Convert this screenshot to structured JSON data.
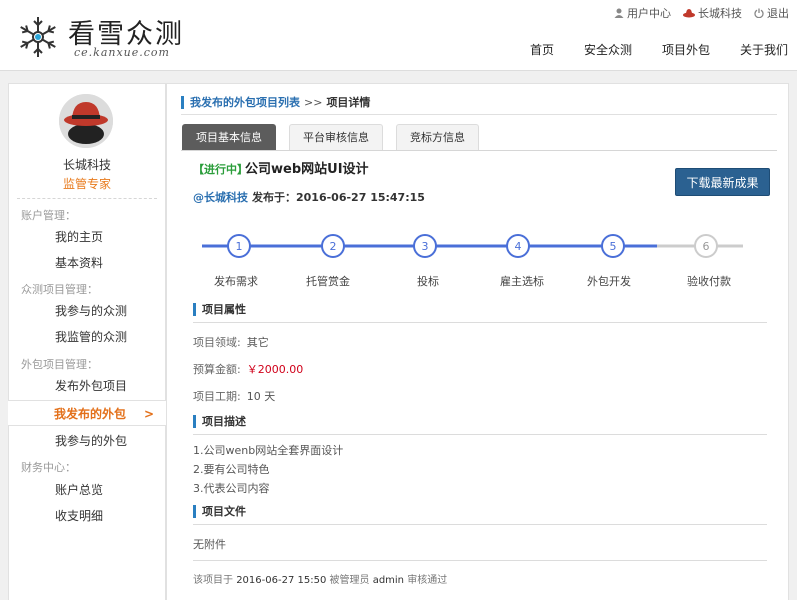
{
  "header": {
    "logo_cn": "看雪众测",
    "logo_en": "ce.kanxue.com",
    "top_links": [
      {
        "label": "用户中心",
        "icon": "user-icon"
      },
      {
        "label": "长城科技",
        "icon": "redhat-icon"
      },
      {
        "label": "退出",
        "icon": "power-icon"
      }
    ],
    "nav": [
      "首页",
      "安全众测",
      "项目外包",
      "关于我们"
    ]
  },
  "sidebar": {
    "user_name": "长城科技",
    "user_role": "监管专家",
    "groups": [
      {
        "label": "账户管理：",
        "items": [
          "我的主页",
          "基本资料"
        ]
      },
      {
        "label": "众测项目管理：",
        "items": [
          "我参与的众测",
          "我监管的众测"
        ]
      },
      {
        "label": "外包项目管理：",
        "items": [
          "发布外包项目",
          "我发布的外包",
          "我参与的外包"
        ]
      },
      {
        "label": "财务中心：",
        "items": [
          "账户总览",
          "收支明细"
        ]
      }
    ],
    "active_item": "我发布的外包",
    "active_chevron": ">"
  },
  "main": {
    "breadcrumb": {
      "link": "我发布的外包项目列表",
      "sep": ">>",
      "current": "项目详情"
    },
    "tabs": [
      "项目基本信息",
      "平台审核信息",
      "竞标方信息"
    ],
    "active_tab": 0,
    "status": "【进行中】",
    "title": "公司web网站UI设计",
    "author": "@长城科技",
    "published": "发布于：2016-06-27 15:47:15",
    "download_label": "下载最新成果",
    "steps": [
      {
        "num": "1",
        "label": "发布需求",
        "done": true
      },
      {
        "num": "2",
        "label": "托管赏金",
        "done": true
      },
      {
        "num": "3",
        "label": "投标",
        "done": true
      },
      {
        "num": "4",
        "label": "雇主选标",
        "done": true
      },
      {
        "num": "5",
        "label": "外包开发",
        "done": true
      },
      {
        "num": "6",
        "label": "验收付款",
        "done": false
      }
    ],
    "sections": {
      "attributes_title": "项目属性",
      "fields": [
        {
          "label": "项目领域:",
          "value": "其它"
        },
        {
          "label": "预算金额:",
          "value": "￥2000.00"
        },
        {
          "label": "项目工期:",
          "value": "10 天"
        }
      ],
      "description_title": "项目描述",
      "description_lines": [
        "1.公司wenb网站全套界面设计",
        "2.要有公司特色",
        "3.代表公司内容"
      ],
      "files_title": "项目文件",
      "files_value": "无附件"
    },
    "footer": {
      "prefix": "该项目于",
      "time": "2016-06-27 15:50",
      "mid": "被管理员",
      "admin": "admin",
      "suffix": "审核通过"
    }
  },
  "colors": {
    "accent_blue": "#2a7fc1",
    "step_active": "#4a6fd8",
    "step_inactive": "#cccccc",
    "status_green": "#2a9d3a",
    "role_orange": "#e87a1c",
    "price_red": "#d0021b",
    "button_dark": "#2b6191"
  }
}
